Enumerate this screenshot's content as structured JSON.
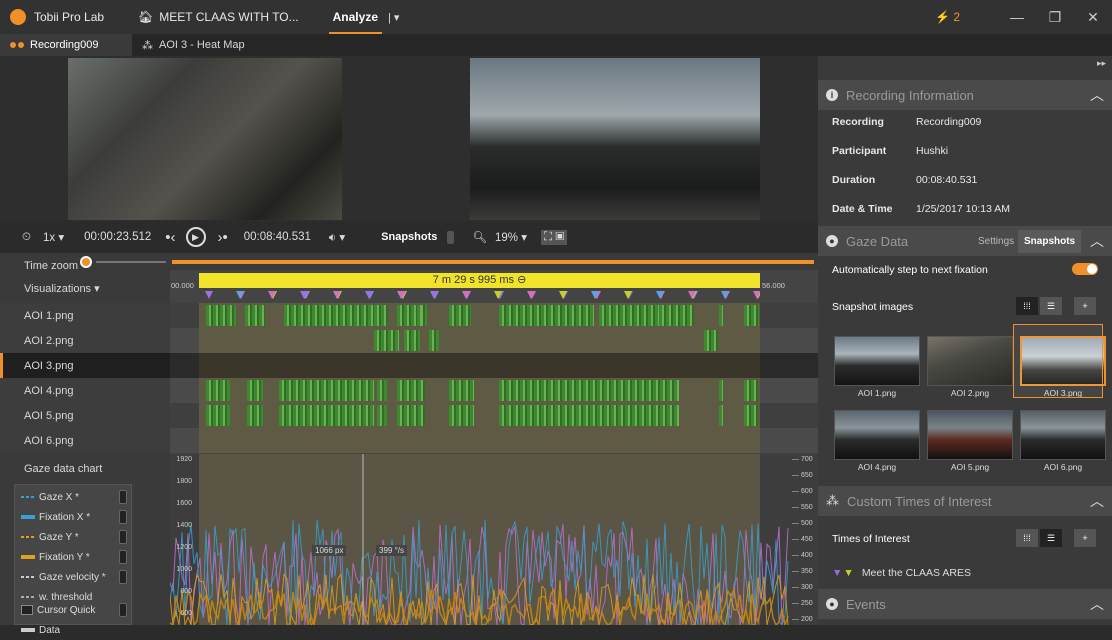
{
  "app": {
    "title": "Tobii Pro Lab",
    "project": "MEET CLAAS WITH TO...",
    "mode": "Analyze",
    "notifications": "2"
  },
  "tabs": [
    {
      "label": "Recording009"
    },
    {
      "label": "AOI 3 - Heat Map"
    }
  ],
  "controls": {
    "speed": "1x",
    "current_time": "00:00:23.512",
    "total_time": "00:08:40.531",
    "snapshots_label": "Snapshots",
    "zoom": "19%"
  },
  "timeline": {
    "time_zoom_label": "Time zoom",
    "visualizations_label": "Visualizations",
    "selection_label": "7 m 29 s 995 ms",
    "start_tick": "00.000",
    "end_tick": "56.000",
    "rows": [
      "AOI 1.png",
      "AOI 2.png",
      "AOI 3.png",
      "AOI 4.png",
      "AOI 5.png",
      "AOI 6.png"
    ],
    "selected_row": "AOI 3.png"
  },
  "gaze_chart": {
    "label": "Gaze data chart",
    "left_ticks": [
      "1920",
      "1800",
      "1600",
      "1400",
      "1200",
      "1000",
      "800",
      "600"
    ],
    "right_ticks": [
      "700",
      "650",
      "600",
      "550",
      "500",
      "450",
      "400",
      "350",
      "300",
      "250",
      "200"
    ],
    "cursor_px": "1066 px",
    "cursor_vel": "399 °/s",
    "legend": [
      {
        "label": "Gaze X",
        "color": "#3aa0d0"
      },
      {
        "label": "Fixation X",
        "color": "#3aa0d0"
      },
      {
        "label": "Gaze Y",
        "color": "#e0a020"
      },
      {
        "label": "Fixation Y",
        "color": "#e0a020"
      },
      {
        "label": "Gaze velocity",
        "color": "#cccccc"
      },
      {
        "label": "w. threshold",
        "color": "#aaaaaa"
      },
      {
        "label": "Cursor Quick",
        "color": "#cccccc"
      },
      {
        "label": "Data",
        "color": "#cccccc"
      }
    ]
  },
  "recording_info": {
    "title": "Recording Information",
    "rows": [
      {
        "key": "Recording",
        "value": "Recording009"
      },
      {
        "key": "Participant",
        "value": "Hushki"
      },
      {
        "key": "Duration",
        "value": "00:08:40.531"
      },
      {
        "key": "Date & Time",
        "value": "1/25/2017 10:13 AM"
      }
    ]
  },
  "gaze_data": {
    "title": "Gaze Data",
    "settings_tab": "Settings",
    "snapshots_tab": "Snapshots",
    "auto_step_label": "Automatically step to next fixation",
    "snapshot_images_label": "Snapshot images",
    "images": [
      "AOI 1.png",
      "AOI 2.png",
      "AOI 3.png",
      "AOI 4.png",
      "AOI 5.png",
      "AOI 6.png"
    ]
  },
  "custom_toi": {
    "title": "Custom Times of Interest",
    "times_label": "Times of Interest",
    "item": "Meet the CLAAS ARES"
  },
  "events": {
    "title": "Events"
  }
}
